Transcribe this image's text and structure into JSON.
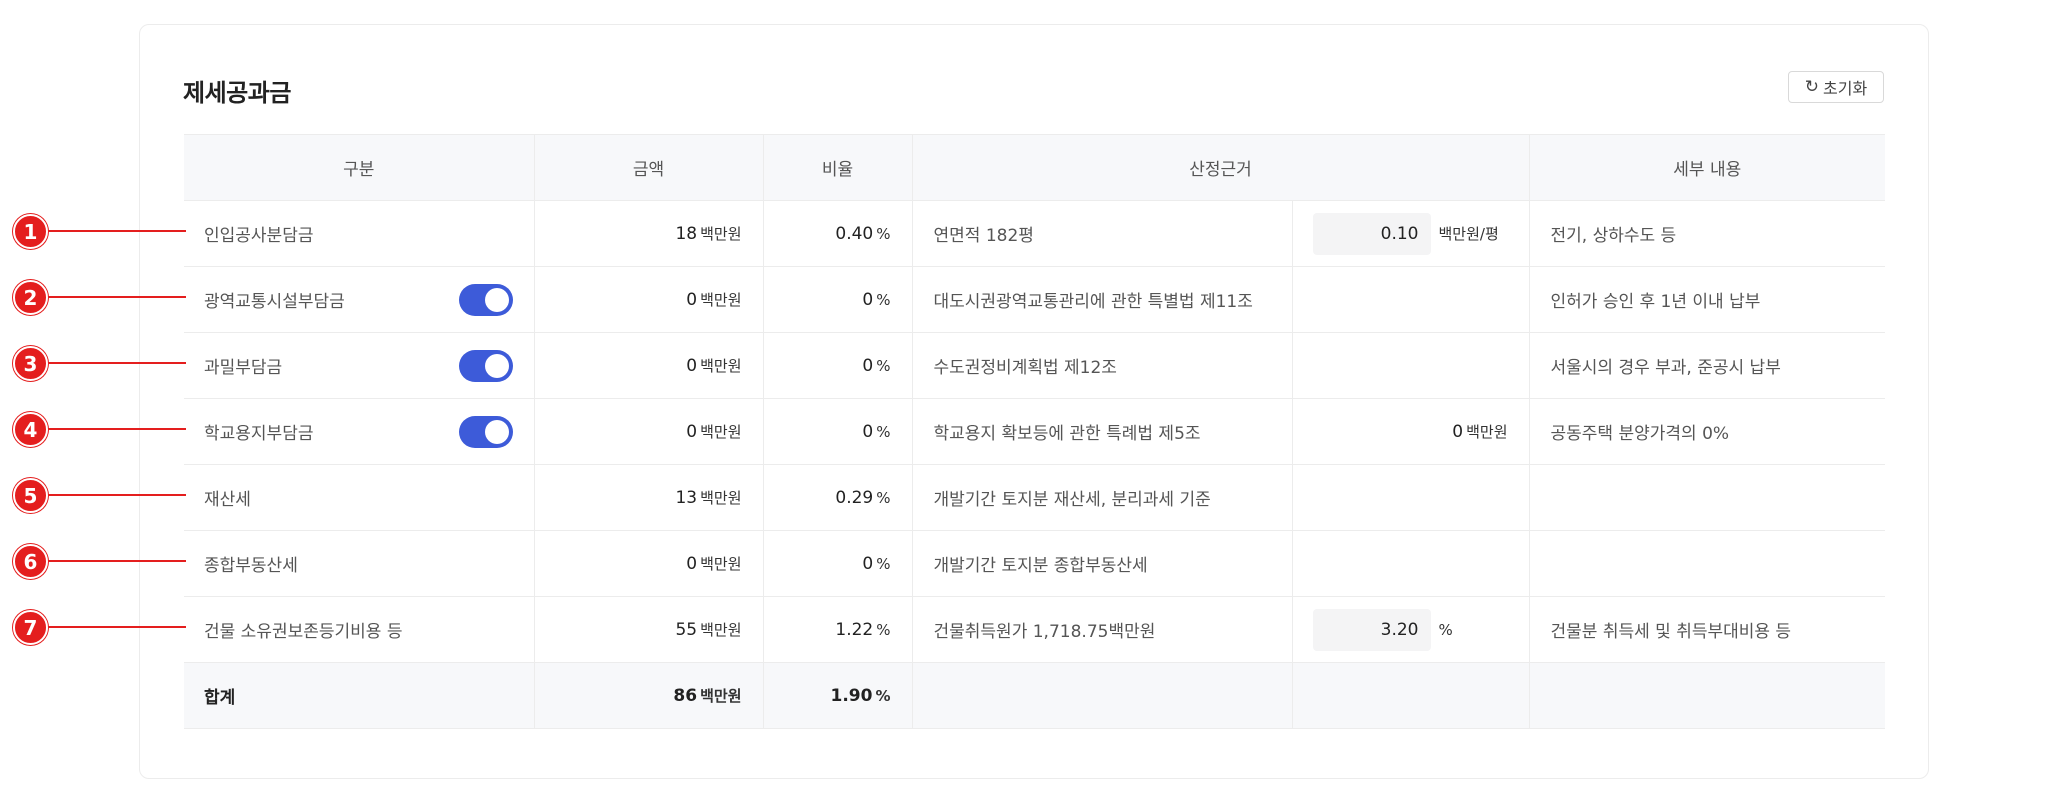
{
  "section": {
    "title": "제세공과금",
    "reset_label": "초기화",
    "reset_icon": "refresh-icon"
  },
  "table": {
    "headers": [
      "구분",
      "금액",
      "비율",
      "산정근거",
      "세부 내용"
    ],
    "rows": [
      {
        "name": "인입공사분담금",
        "amount": "18",
        "unit": "백만원",
        "ratio": "0.40",
        "ratio_unit": "%",
        "basis": "연면적 182평",
        "input_value": "0.10",
        "input_unit": "백만원/평",
        "detail": "전기, 상하수도 등"
      },
      {
        "name": "광역교통시설부담금",
        "toggle": true,
        "amount": "0",
        "unit": "백만원",
        "ratio": "0",
        "ratio_unit": "%",
        "basis": "대도시권광역교통관리에 관한 특별법 제11조",
        "detail": "인허가 승인 후 1년 이내 납부"
      },
      {
        "name": "과밀부담금",
        "toggle": true,
        "amount": "0",
        "unit": "백만원",
        "ratio": "0",
        "ratio_unit": "%",
        "basis": "수도권정비계획법 제12조",
        "detail": "서울시의 경우 부과, 준공시 납부"
      },
      {
        "name": "학교용지부담금",
        "toggle": true,
        "amount": "0",
        "unit": "백만원",
        "ratio": "0",
        "ratio_unit": "%",
        "basis": "학교용지 확보등에 관한 특례법 제5조",
        "calc_value": "0",
        "calc_unit": "백만원",
        "detail": "공동주택 분양가격의 0%"
      },
      {
        "name": "재산세",
        "amount": "13",
        "unit": "백만원",
        "ratio": "0.29",
        "ratio_unit": "%",
        "basis": "개발기간 토지분 재산세, 분리과세 기준",
        "detail": ""
      },
      {
        "name": "종합부동산세",
        "amount": "0",
        "unit": "백만원",
        "ratio": "0",
        "ratio_unit": "%",
        "basis": "개발기간 토지분 종합부동산세",
        "detail": ""
      },
      {
        "name": "건물 소유권보존등기비용 등",
        "amount": "55",
        "unit": "백만원",
        "ratio": "1.22",
        "ratio_unit": "%",
        "basis": "건물취득원가 1,718.75백만원",
        "input_value": "3.20",
        "input_unit": "%",
        "detail": "건물분 취득세 및 취득부대비용 등"
      }
    ],
    "total": {
      "name": "합계",
      "amount": "86",
      "unit": "백만원",
      "ratio": "1.90",
      "ratio_unit": "%"
    }
  },
  "markers": [
    "1",
    "2",
    "3",
    "4",
    "5",
    "6",
    "7"
  ],
  "colors": {
    "accent": "#3d5bd9",
    "marker": "#e41e1e",
    "header_bg": "#f7f8fa",
    "input_bg": "#f4f4f5"
  }
}
